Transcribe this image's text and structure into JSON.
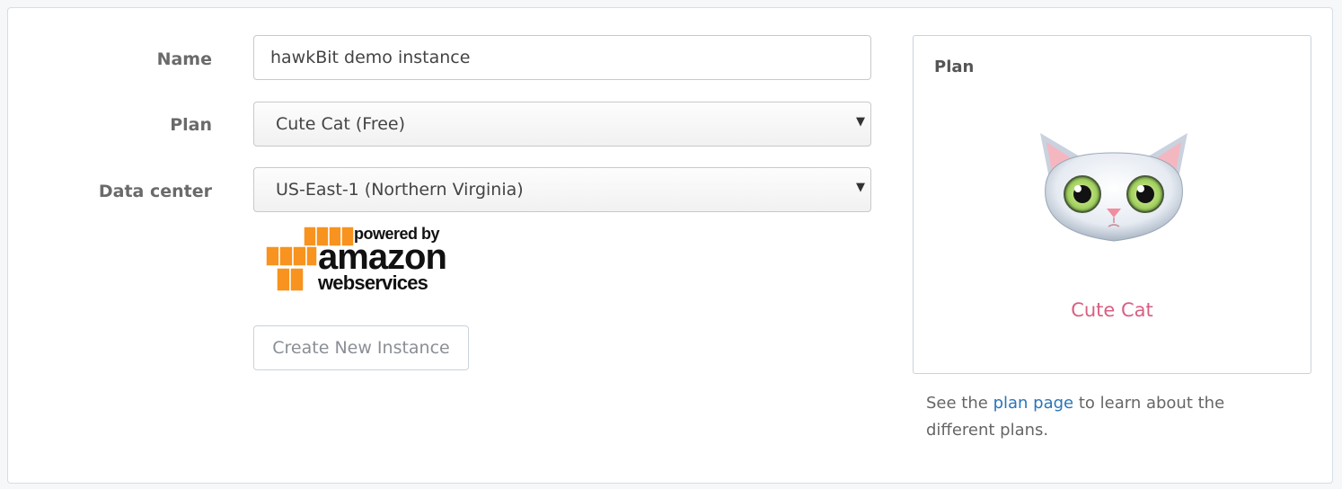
{
  "form": {
    "name_label": "Name",
    "name_value": "hawkBit demo instance",
    "plan_label": "Plan",
    "plan_value": "Cute Cat (Free)",
    "datacenter_label": "Data center",
    "datacenter_value": "US-East-1 (Northern Virginia)",
    "create_button": "Create New Instance"
  },
  "aws_logo": {
    "line1": "powered by",
    "line2": "amazon",
    "line3": "webservices",
    "color": "#f7931e"
  },
  "plan_panel": {
    "title": "Plan",
    "plan_name": "Cute Cat",
    "icon": "cat-face-icon",
    "accent": "#d85f83"
  },
  "note": {
    "before": "See the ",
    "link": "plan page",
    "after": " to learn about the different plans."
  }
}
